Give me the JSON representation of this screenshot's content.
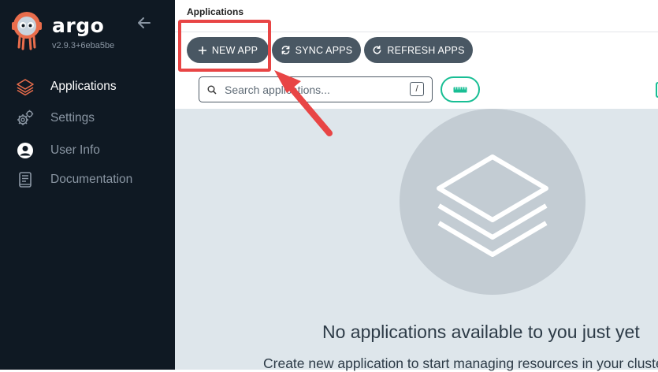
{
  "sidebar": {
    "brand": "argo",
    "version": "v2.9.3+6eba5be",
    "items": [
      {
        "label": "Applications",
        "icon": "layers-icon",
        "active": true
      },
      {
        "label": "Settings",
        "icon": "gears-icon",
        "active": false
      },
      {
        "label": "User Info",
        "icon": "user-circle-icon",
        "active": false
      },
      {
        "label": "Documentation",
        "icon": "book-icon",
        "active": false
      }
    ]
  },
  "header": {
    "title": "Applications"
  },
  "toolbar": {
    "new_app": "NEW APP",
    "sync_apps": "SYNC APPS",
    "refresh_apps": "REFRESH APPS"
  },
  "search": {
    "placeholder": "Search applications...",
    "shortcut": "/"
  },
  "empty_state": {
    "title": "No applications available to you just yet",
    "subtitle": "Create new application to start managing resources in your cluster"
  },
  "colors": {
    "sidebar_bg": "#0f1923",
    "button_bg": "#495763",
    "accent_teal": "#18be94",
    "annotation_red": "#e84545",
    "argo_orange": "#e96d4c"
  }
}
